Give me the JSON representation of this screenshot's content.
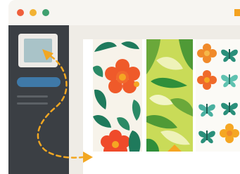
{
  "window": {
    "controls": [
      "close",
      "minimize",
      "maximize"
    ]
  },
  "sidebar": {
    "thumbnail_icon": "image-thumbnail-icon",
    "items": [
      "selected-pill",
      "text-line",
      "text-line"
    ]
  },
  "main": {
    "patterns": [
      {
        "name": "floral",
        "colors": [
          "#ef5a2a",
          "#1f7a5c",
          "#f5a623"
        ]
      },
      {
        "name": "leaf",
        "colors": [
          "#c9db58",
          "#6aa83a",
          "#2f8f3a"
        ]
      },
      {
        "name": "butterfly-flower",
        "colors": [
          "#f08a2a",
          "#49b0a0",
          "#f5a623"
        ]
      }
    ]
  },
  "colors": {
    "accent": "#f2a722",
    "sidebar_bg": "#3b3f44",
    "selected_pill": "#3f79a8"
  }
}
